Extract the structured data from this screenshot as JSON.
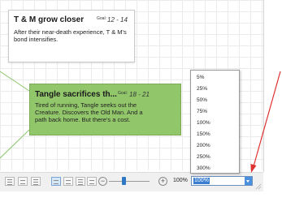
{
  "cards": [
    {
      "title": "T & M grow closer",
      "goal_label": "Goal:",
      "goal_range": "12 - 14",
      "body": "After their near-death experience, T & M's bond intensifies."
    },
    {
      "title": "Tangle sacrifices th...",
      "goal_label": "Goal:",
      "goal_range": "18 - 21",
      "body": "Tired of running, Tangle seeks out the Creature. Discovers the Old Man. And a path back home. But there's a cost.",
      "color": "#92c66b"
    }
  ],
  "zoom": {
    "options": [
      "5%",
      "25%",
      "50%",
      "75%",
      "100%",
      "150%",
      "200%",
      "250%",
      "300%"
    ],
    "percent_label": "100%",
    "current_value": "100%",
    "slider_level_percent": 100
  },
  "annotation": {
    "arrow_color": "#e03131"
  },
  "colors": {
    "accent": "#3b7fd0"
  }
}
